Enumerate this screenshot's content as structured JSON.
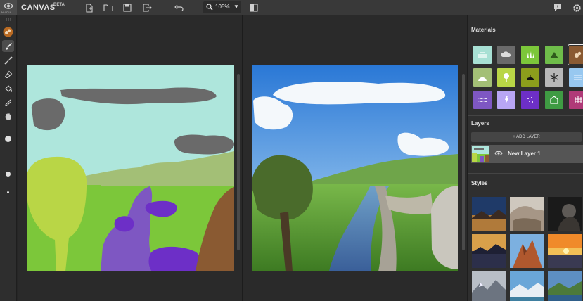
{
  "app": {
    "logo_text": "NVIDIA",
    "title": "CANVAS",
    "badge": "BETA"
  },
  "toolbar": {
    "zoom_value": "105%",
    "icons": [
      "new-file-icon",
      "open-folder-icon",
      "save-icon",
      "export-icon",
      "undo-icon",
      "zoom-icon",
      "dropdown-caret-icon",
      "split-view-icon",
      "feedback-icon",
      "settings-icon"
    ]
  },
  "tools": [
    "drag-handle-icon",
    "material-picker-icon",
    "brush-icon",
    "line-icon",
    "eraser-icon",
    "fill-bucket-icon",
    "eyedropper-icon",
    "pan-hand-icon"
  ],
  "tool_state": {
    "active_tool": "brush"
  },
  "sliders": {
    "brush_size_fraction": 0.35
  },
  "materials_panel": {
    "title": "Materials",
    "selected_index": 4,
    "items": [
      {
        "name": "sea-icon",
        "color": "#a8e0d4"
      },
      {
        "name": "cloud-icon",
        "color": "#6a6a6a"
      },
      {
        "name": "grass-icon",
        "color": "#7cc73a"
      },
      {
        "name": "mountain-icon",
        "color": "#6fbd4a"
      },
      {
        "name": "dirt-icon",
        "color": "#8a5a32"
      },
      {
        "name": "hill-icon",
        "color": "#a3bf76"
      },
      {
        "name": "tree-icon",
        "color": "#b9d646"
      },
      {
        "name": "bush-icon",
        "color": "#8c9e1c"
      },
      {
        "name": "snow-icon",
        "color": "#b8b8b8"
      },
      {
        "name": "water-icon",
        "color": "#98c8f0"
      },
      {
        "name": "river-icon",
        "color": "#7e57c2"
      },
      {
        "name": "flower-icon",
        "color": "#b8a6f4"
      },
      {
        "name": "stone-icon",
        "color": "#6d2fc7"
      },
      {
        "name": "building-icon",
        "color": "#3f9b43"
      },
      {
        "name": "fence-icon",
        "color": "#b03a78"
      }
    ]
  },
  "layers_panel": {
    "title": "Layers",
    "add_label": "+ ADD LAYER",
    "layers": [
      {
        "name": "New Layer 1",
        "visible": true
      }
    ]
  },
  "styles_panel": {
    "title": "Styles",
    "count": 9
  },
  "colors": {
    "accent": "#f0f0f0",
    "panel": "#2f2f2f",
    "topbar": "#393939"
  }
}
